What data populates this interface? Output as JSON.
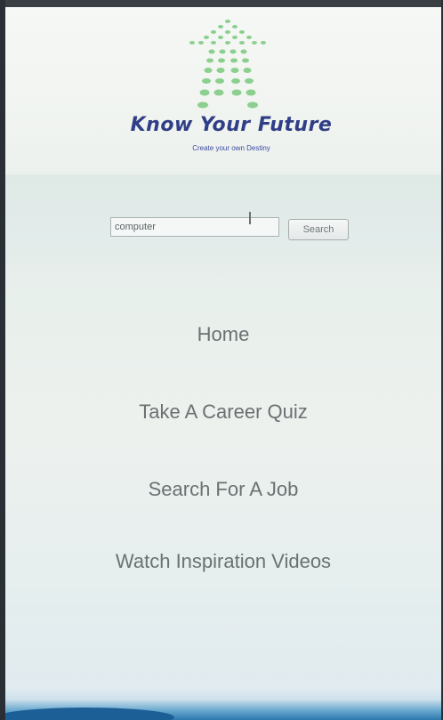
{
  "brand": {
    "title": "Know Your Future",
    "tagline": "Create your own Destiny",
    "logo_icon": "dotted-arrow-up-icon",
    "title_color": "#2f3e86",
    "logo_color": "#8ccf8e"
  },
  "search": {
    "value": "computer",
    "button_label": "Search"
  },
  "nav": {
    "items": [
      {
        "label": "Home"
      },
      {
        "label": "Take A Career Quiz"
      },
      {
        "label": "Search For A Job"
      },
      {
        "label": "Watch Inspiration Videos"
      }
    ]
  }
}
